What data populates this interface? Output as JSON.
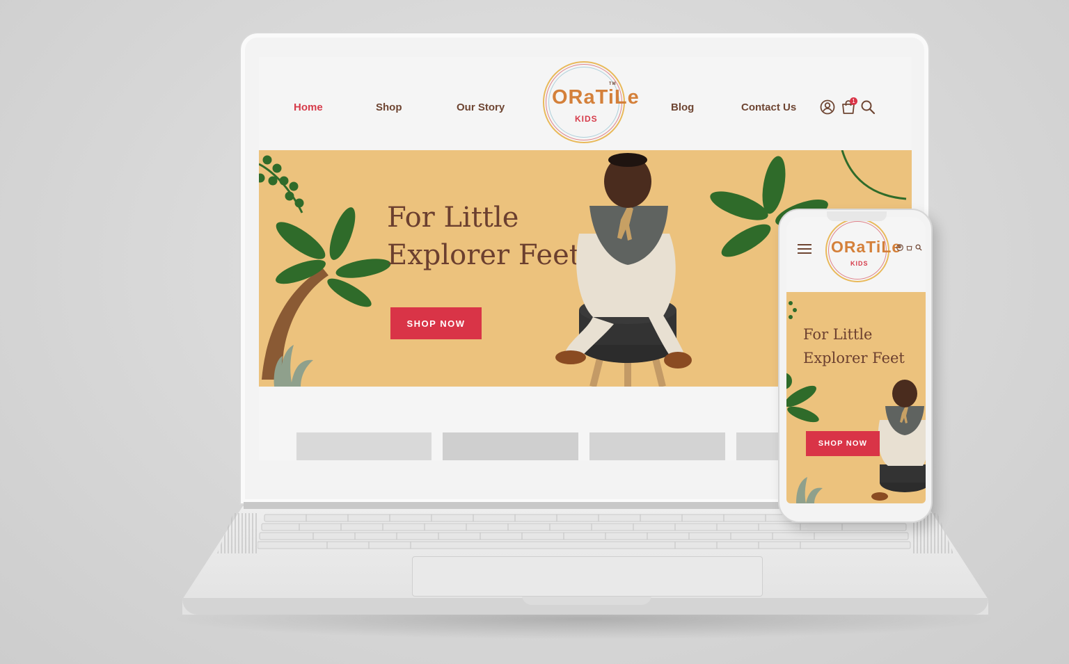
{
  "colors": {
    "brand_brown": "#6e4532",
    "accent_red": "#d93447",
    "hero_bg": "#ecc27d",
    "leaf_green": "#2f6b2a"
  },
  "desktop": {
    "nav": {
      "left_items": [
        {
          "label": "Home",
          "active": true
        },
        {
          "label": "Shop",
          "active": false
        },
        {
          "label": "Our Story",
          "active": false
        }
      ],
      "right_items": [
        {
          "label": "Blog",
          "active": false
        },
        {
          "label": "Contact Us",
          "active": false
        }
      ],
      "cart_count": "1",
      "icons": [
        "user-icon",
        "cart-icon",
        "search-icon"
      ]
    },
    "logo": {
      "main": "ORaTiLe",
      "sub": "KIDS",
      "tm": "TM"
    },
    "hero": {
      "title_line1": "For Little",
      "title_line2": "Explorer Feet",
      "button": "SHOP NOW"
    }
  },
  "mobile": {
    "logo": {
      "main": "ORaTiLe",
      "sub": "KIDS"
    },
    "icons": [
      "menu-icon",
      "user-icon",
      "cart-icon",
      "search-icon"
    ],
    "hero": {
      "title_line1": "For Little",
      "title_line2": "Explorer Feet",
      "button": "SHOP NOW"
    }
  }
}
